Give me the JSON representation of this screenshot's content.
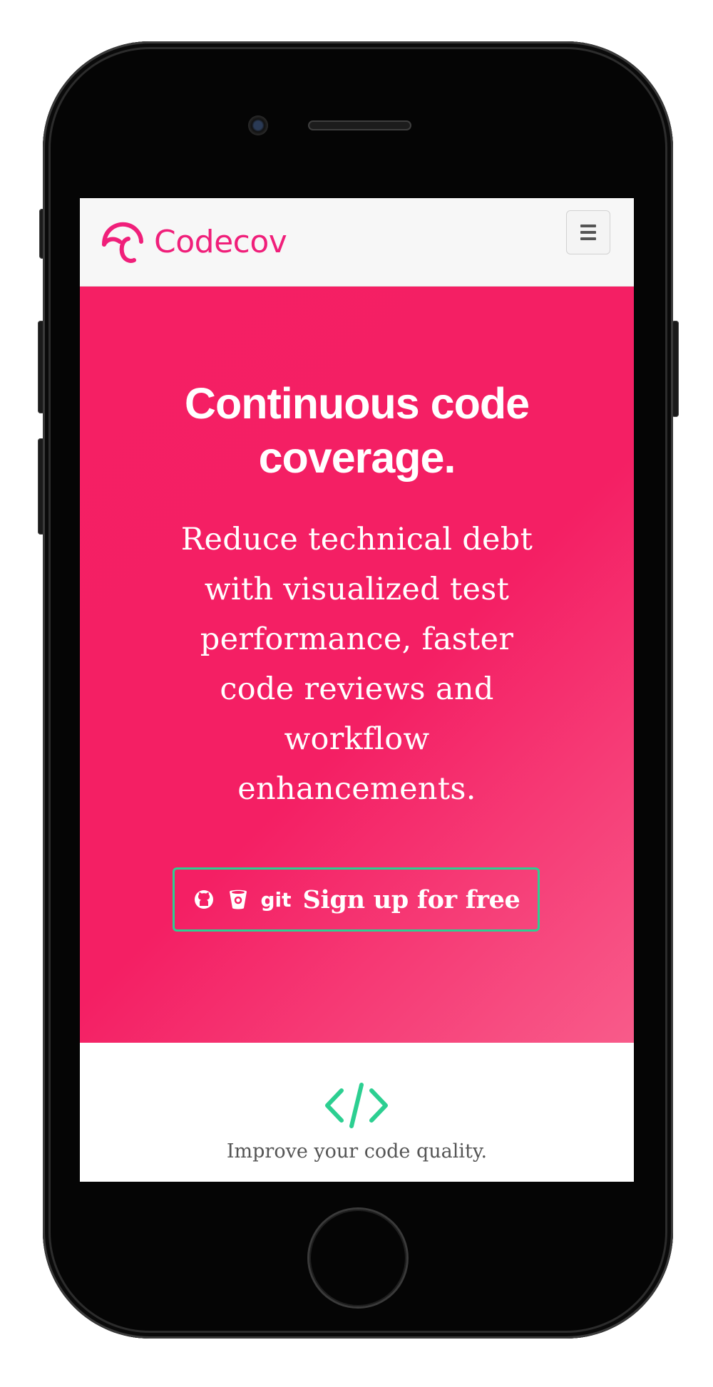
{
  "navbar": {
    "brand_name": "Codecov",
    "brand_logo_icon": "codecov-umbrella-icon",
    "menu_icon": "hamburger-icon"
  },
  "hero": {
    "title": "Continuous code coverage.",
    "subtitle": "Reduce technical debt with visualized test performance, faster code reviews and workflow enhancements.",
    "signup_button": {
      "label": "Sign up for free",
      "icons": [
        "github-icon",
        "bitbucket-icon",
        "git-icon"
      ],
      "git_text": "git"
    }
  },
  "features": {
    "icon": "code-brackets-icon",
    "title": "Improve your code quality."
  },
  "colors": {
    "brand": "#f01f7a",
    "hero_start": "#f51f64",
    "hero_end": "#f85b8a",
    "button_border": "#2ccf91",
    "code_icon": "#2ccf91"
  }
}
